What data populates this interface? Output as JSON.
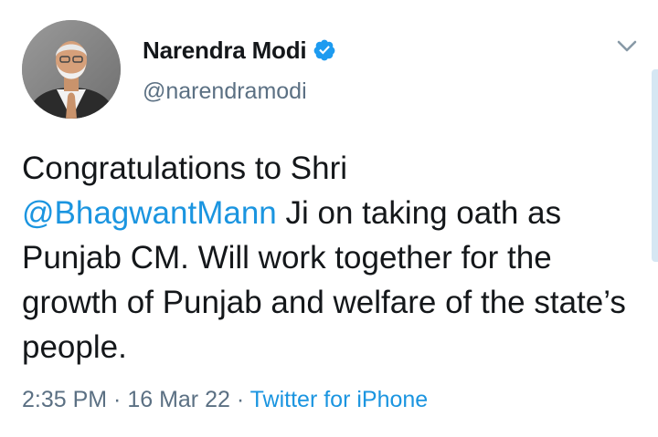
{
  "tweet": {
    "author": {
      "display_name": "Narendra Modi",
      "handle": "@narendramodi",
      "verified": true,
      "avatar_icon": "profile-photo"
    },
    "text": {
      "part1": "Congratulations to Shri",
      "mention": "@BhagwantMann",
      "part2": " Ji on taking oath as Punjab CM. Will work together for the growth of Punjab and welfare of the state’s people."
    },
    "meta": {
      "time": "2:35 PM",
      "separator": " · ",
      "date": "16 Mar 22",
      "source": "Twitter for iPhone"
    },
    "menu_icon": "chevron-down-icon"
  },
  "colors": {
    "link": "#1b95e0",
    "secondary_text": "#5b7083",
    "verified_badge": "#1d9bf0"
  }
}
